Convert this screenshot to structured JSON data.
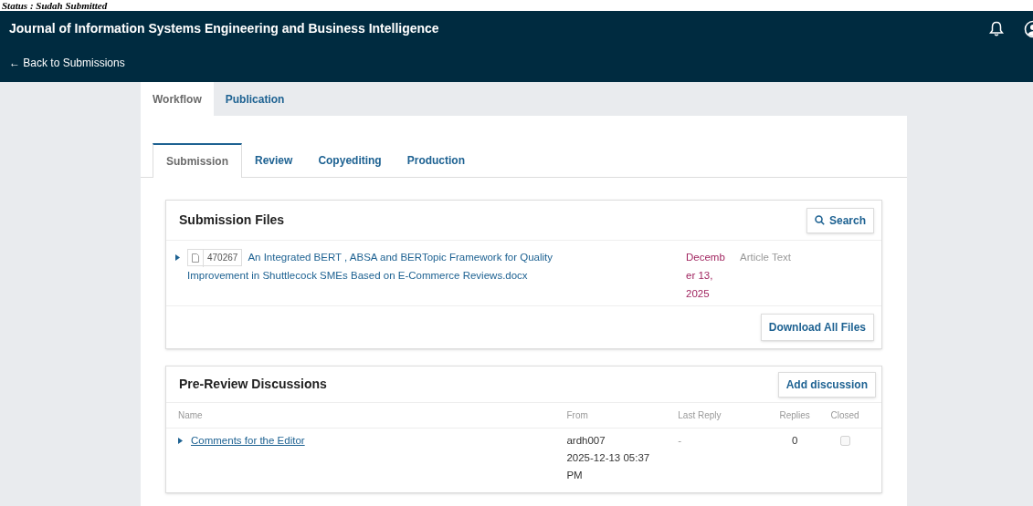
{
  "page_caption": "Status : Sudah Submitted",
  "header": {
    "title": "Journal of Information Systems Engineering and Business Intelligence",
    "back_link": "← Back to Submissions"
  },
  "main_tabs": [
    {
      "label": "Workflow",
      "selected": true
    },
    {
      "label": "Publication",
      "selected": false
    }
  ],
  "stage_tabs": [
    {
      "label": "Submission",
      "selected": true
    },
    {
      "label": "Review",
      "selected": false
    },
    {
      "label": "Copyediting",
      "selected": false
    },
    {
      "label": "Production",
      "selected": false
    }
  ],
  "submission_files": {
    "title": "Submission Files",
    "search_button": "Search",
    "files": [
      {
        "id": "470267",
        "name": "An Integrated BERT , ABSA and BERTopic Framework for Quality Improvement in Shuttlecock SMEs Based on E-Commerce Reviews.docx",
        "date": "December 13, 2025",
        "type": "Article Text"
      }
    ],
    "download_button": "Download All Files"
  },
  "discussions": {
    "title": "Pre-Review Discussions",
    "add_button": "Add discussion",
    "columns": [
      "Name",
      "From",
      "Last Reply",
      "Replies",
      "Closed"
    ],
    "rows": [
      {
        "name": "Comments for the Editor",
        "from_user": "ardh007",
        "from_date": "2025-12-13 05:37 PM",
        "last_reply": "-",
        "replies": "0",
        "closed": false
      }
    ]
  }
}
